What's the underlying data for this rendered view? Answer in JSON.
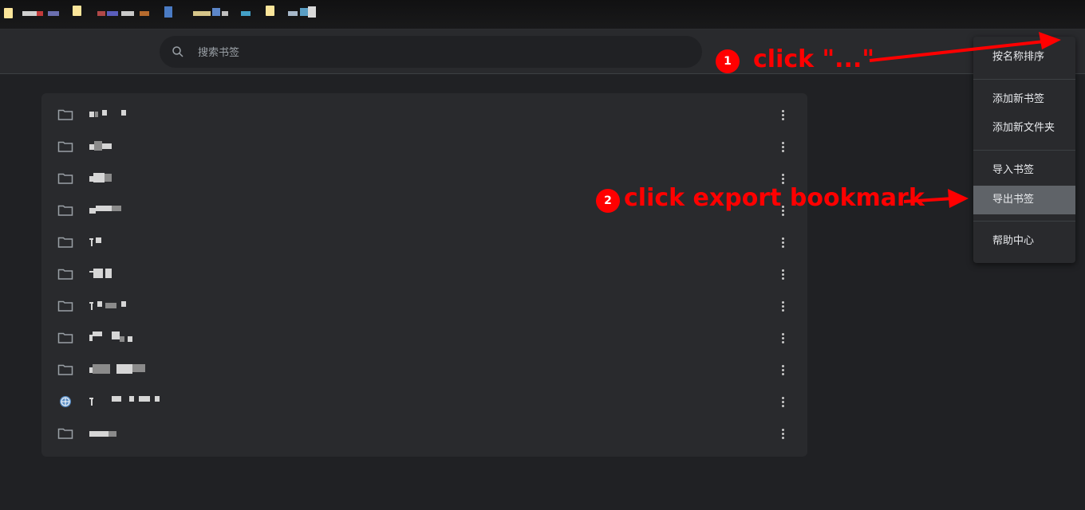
{
  "search": {
    "placeholder": "搜索书签"
  },
  "menu": {
    "items": [
      {
        "label": "按名称排序"
      },
      {
        "label": "添加新书签"
      },
      {
        "label": "添加新文件夹"
      },
      {
        "label": "导入书签"
      },
      {
        "label": "导出书签"
      },
      {
        "label": "帮助中心"
      }
    ]
  },
  "annotations": {
    "step1": {
      "number": "1",
      "text": "click \"...\""
    },
    "step2": {
      "number": "2",
      "text": "click export bookmark"
    },
    "color": "#ff0000"
  },
  "bookmarks": [
    {
      "icon": "folder-icon"
    },
    {
      "icon": "folder-icon"
    },
    {
      "icon": "folder-icon"
    },
    {
      "icon": "folder-icon"
    },
    {
      "icon": "folder-icon"
    },
    {
      "icon": "folder-icon"
    },
    {
      "icon": "folder-icon"
    },
    {
      "icon": "folder-icon"
    },
    {
      "icon": "folder-icon"
    },
    {
      "icon": "globe-icon"
    },
    {
      "icon": "folder-icon"
    }
  ]
}
